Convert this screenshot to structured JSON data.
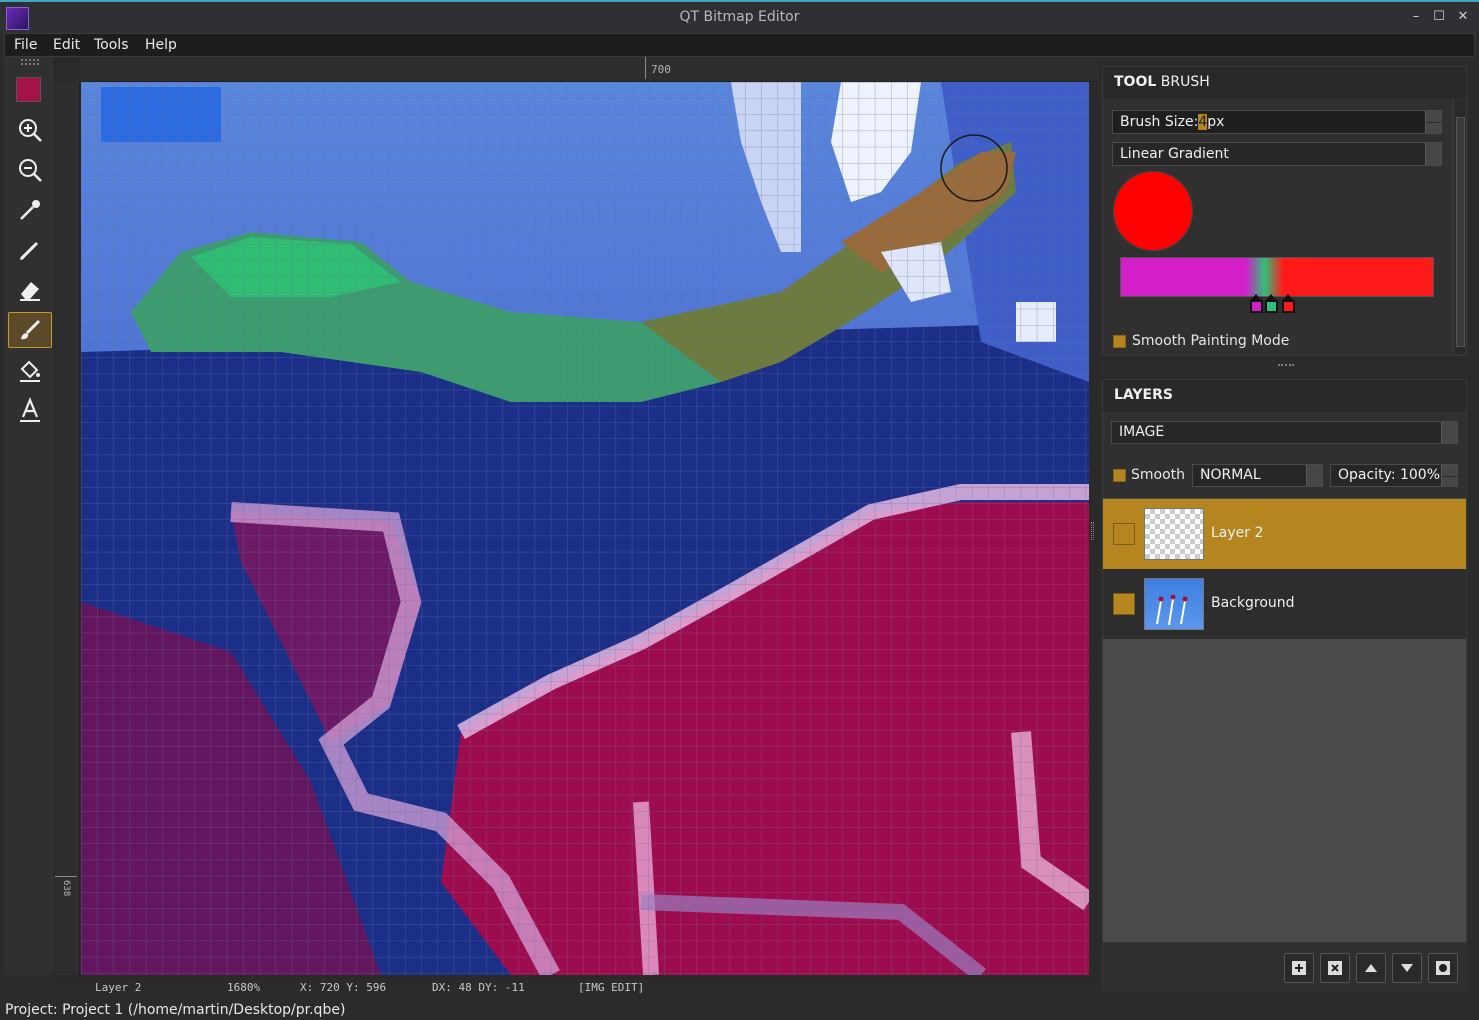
{
  "window": {
    "title": "QT Bitmap Editor"
  },
  "menu": {
    "file": "File",
    "edit": "Edit",
    "tools": "Tools",
    "help": "Help"
  },
  "toolbar": {
    "current_color": "#a4124a",
    "tools": [
      "zoom-in-icon",
      "zoom-out-icon",
      "eyedropper-icon",
      "pencil-icon",
      "eraser-icon",
      "brush-icon",
      "fill-bucket-icon",
      "text-icon"
    ],
    "active_tool": "brush-icon"
  },
  "rulers": {
    "top_label": "700",
    "left_label": "638"
  },
  "tool_panel": {
    "title_prefix": "TOOL",
    "title_name": "BRUSH",
    "brush_size_label": "Brush Size:",
    "brush_size_value": "4",
    "brush_size_unit": "px",
    "mode": "Linear Gradient",
    "color": "#ff0000",
    "gradient_stops": [
      "#d21fc8",
      "#2ebf7a",
      "#ff1a1a"
    ],
    "smooth_painting_label": "Smooth Painting Mode"
  },
  "layers_panel": {
    "title": "LAYERS",
    "layer_type": "IMAGE",
    "smooth_label": "Smooth",
    "blend_mode": "NORMAL",
    "opacity_label": "Opacity: 100%",
    "layers": [
      {
        "name": "Layer 2",
        "selected": true,
        "visible": false
      },
      {
        "name": "Background",
        "selected": false,
        "visible": true
      }
    ]
  },
  "status": {
    "layer": "Layer 2",
    "zoom": "1680%",
    "coords": "X: 720 Y: 596",
    "delta": "DX: 48 DY: -11",
    "mode": "[IMG EDIT]"
  },
  "project": "Project: Project 1 (/home/martin/Desktop/pr.qbe)"
}
